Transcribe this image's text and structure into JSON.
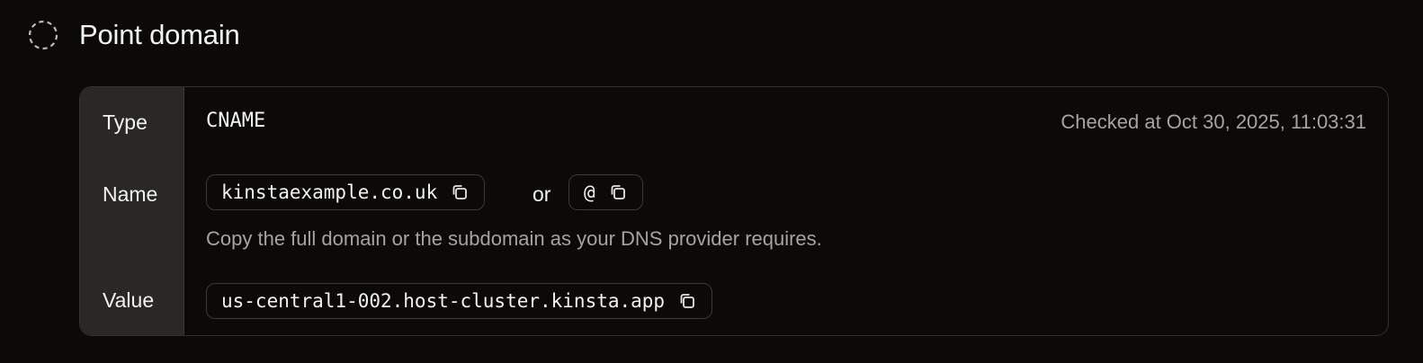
{
  "step": {
    "title": "Point domain",
    "status_icon": "pending-circle-icon"
  },
  "record": {
    "type_label": "Type",
    "type_value": "CNAME",
    "checked_at": "Checked at Oct 30, 2025, 11:03:31",
    "name_label": "Name",
    "name_primary": "kinstaexample.co.uk",
    "name_separator": "or",
    "name_alternate": "@",
    "name_hint": "Copy the full domain or the subdomain as your DNS provider requires.",
    "value_label": "Value",
    "value": "us-central1-002.host-cluster.kinsta.app"
  },
  "colors": {
    "background": "#0b0a09",
    "label_column": "#2a2827",
    "border": "#333130",
    "muted_text": "#a6a3a0"
  }
}
